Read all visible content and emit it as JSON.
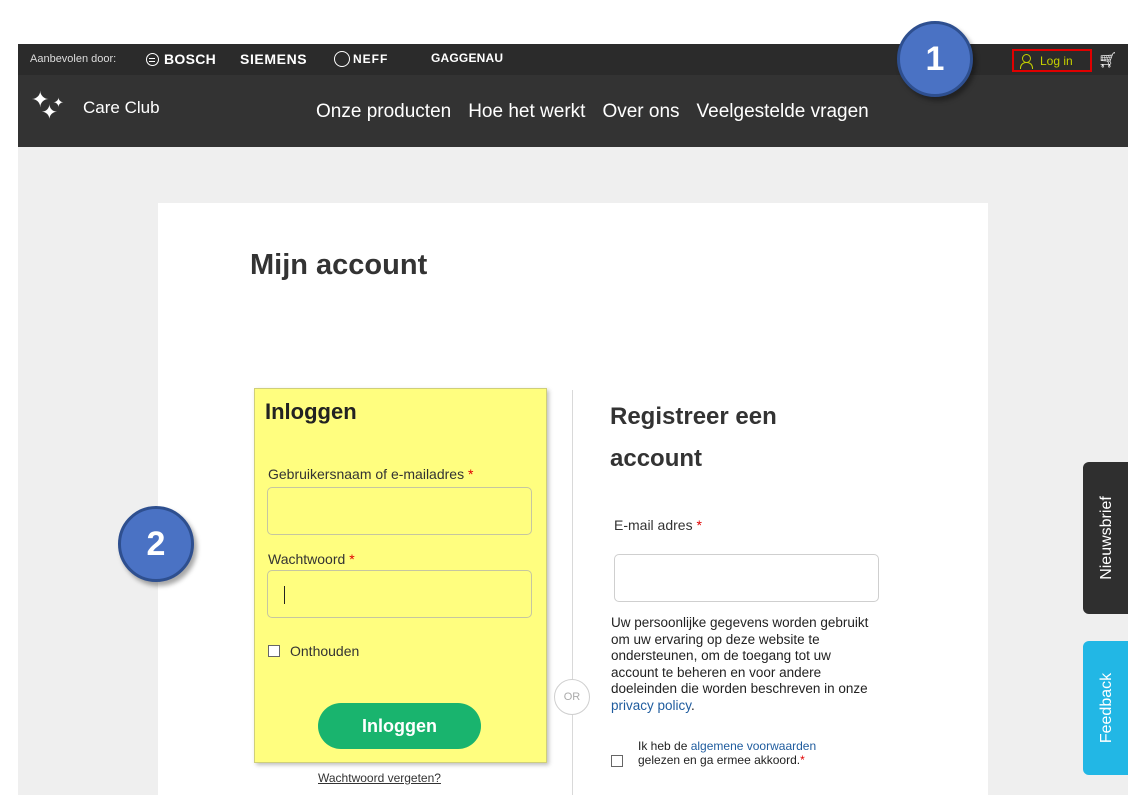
{
  "topbar": {
    "recommended_label": "Aanbevolen door:",
    "brands": [
      "BOSCH",
      "SIEMENS",
      "NEFF",
      "GAGGENAU"
    ],
    "login_label": "Log in",
    "cart_icon": "cart-icon"
  },
  "header": {
    "logo_text": "Care Club",
    "nav": [
      "Onze producten",
      "Hoe het werkt",
      "Over ons",
      "Veelgestelde vragen"
    ]
  },
  "page": {
    "title": "Mijn account"
  },
  "login": {
    "title": "Inloggen",
    "username_label": "Gebruikersnaam of e-mailadres",
    "password_label": "Wachtwoord",
    "required_marker": "*",
    "username_value": "",
    "password_value": "",
    "remember_label": "Onthouden",
    "submit_label": "Inloggen",
    "forgot_label": "Wachtwoord vergeten?"
  },
  "divider": {
    "or_label": "OR"
  },
  "register": {
    "title": "Registreer een account",
    "email_label": "E-mail adres",
    "required_marker": "*",
    "email_value": "",
    "privacy_text": "Uw persoonlijke gegevens worden gebruikt om uw ervaring op deze website te ondersteunen, om de toegang tot uw account te beheren en voor andere doeleinden die worden beschreven in onze ",
    "privacy_link": "privacy policy",
    "privacy_end": ".",
    "terms_prefix": "Ik heb de ",
    "terms_link": "algemene voorwaarden",
    "terms_suffix": " gelezen en ga ermee akkoord.",
    "terms_required": "*"
  },
  "side_tabs": {
    "newsletter": "Nieuwsbrief",
    "feedback": "Feedback"
  },
  "annotations": {
    "marker_1": "1",
    "marker_2": "2"
  },
  "colors": {
    "topbar": "#2b2b2b",
    "navbar": "#333333",
    "highlight": "#fffe7f",
    "login_button": "#19b46e",
    "login_link": "#c6d100",
    "link": "#1f5c9e",
    "feedback_tab": "#22b7e5",
    "newsletter_tab": "#2f2f2f",
    "marker": "#4a72c4",
    "highlight_border": "#e00000"
  }
}
